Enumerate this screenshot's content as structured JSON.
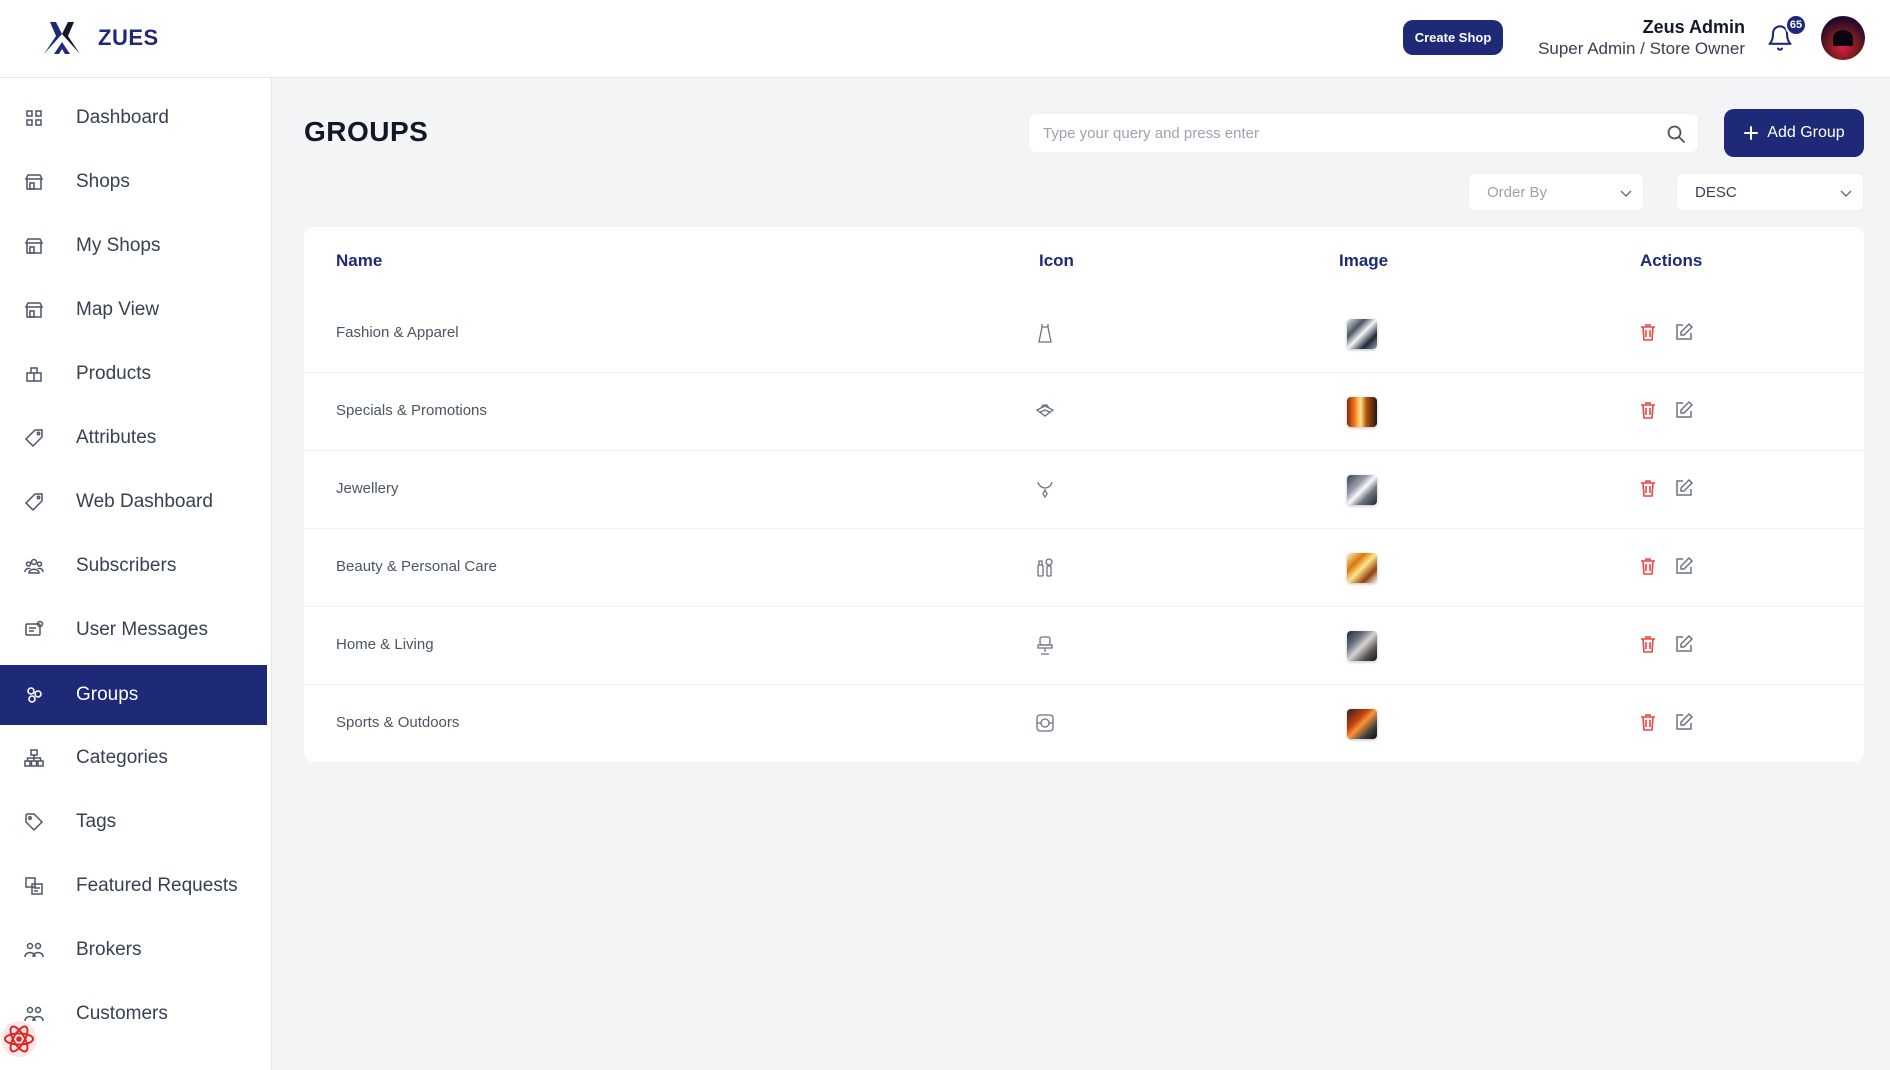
{
  "app": {
    "brand": "ZUES"
  },
  "header": {
    "create_shop_label": "Create Shop",
    "user_name": "Zeus Admin",
    "user_role": "Super Admin / Store Owner",
    "notification_count": "65"
  },
  "sidebar": {
    "items": [
      {
        "label": "Dashboard",
        "icon": "grid-icon"
      },
      {
        "label": "Shops",
        "icon": "store-icon"
      },
      {
        "label": "My Shops",
        "icon": "store-icon"
      },
      {
        "label": "Map View",
        "icon": "store-icon"
      },
      {
        "label": "Products",
        "icon": "products-icon"
      },
      {
        "label": "Attributes",
        "icon": "tag-icon"
      },
      {
        "label": "Web Dashboard",
        "icon": "tag-icon"
      },
      {
        "label": "Subscribers",
        "icon": "users-icon"
      },
      {
        "label": "User Messages",
        "icon": "message-icon"
      },
      {
        "label": "Groups",
        "icon": "groups-icon",
        "active": true
      },
      {
        "label": "Categories",
        "icon": "hierarchy-icon"
      },
      {
        "label": "Tags",
        "icon": "tag-outline-icon"
      },
      {
        "label": "Featured Requests",
        "icon": "featured-icon"
      },
      {
        "label": "Brokers",
        "icon": "people-icon"
      },
      {
        "label": "Customers",
        "icon": "people-icon"
      }
    ]
  },
  "main": {
    "title": "GROUPS",
    "search_placeholder": "Type your query and press enter",
    "add_group_label": "Add Group",
    "order_by_placeholder": "Order By",
    "order_direction": "DESC",
    "columns": [
      "Name",
      "Icon",
      "Image",
      "Actions"
    ],
    "rows": [
      {
        "name": "Fashion & Apparel",
        "icon": "dress-icon"
      },
      {
        "name": "Specials & Promotions",
        "icon": "promo-icon"
      },
      {
        "name": "Jewellery",
        "icon": "necklace-icon"
      },
      {
        "name": "Beauty & Personal Care",
        "icon": "beauty-icon"
      },
      {
        "name": "Home & Living",
        "icon": "chair-icon"
      },
      {
        "name": "Sports & Outdoors",
        "icon": "sports-icon"
      }
    ]
  },
  "colors": {
    "primary": "#1e2a78",
    "delete": "#ef4444",
    "background": "#f3f4f6"
  }
}
